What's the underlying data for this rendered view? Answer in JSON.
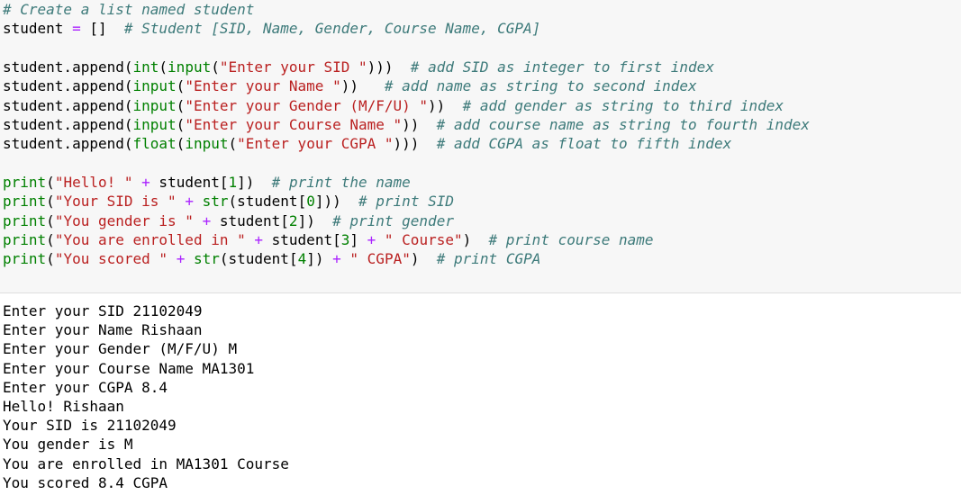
{
  "code_lines": [
    [
      "# Create a list named student"
    ],
    [
      "student ",
      "=",
      " []  ",
      "# Student [SID, Name, Gender, Course Name, CGPA]"
    ],
    [
      ""
    ],
    [
      "student.append(",
      "int",
      "(",
      "input",
      "(",
      "\"Enter your SID \"",
      ")))  ",
      "# add SID as integer to first index"
    ],
    [
      "student.append(",
      "input",
      "(",
      "\"Enter your Name \"",
      "))   ",
      "# add name as string to second index"
    ],
    [
      "student.append(",
      "input",
      "(",
      "\"Enter your Gender (M/F/U) \"",
      "))  ",
      "# add gender as string to third index"
    ],
    [
      "student.append(",
      "input",
      "(",
      "\"Enter your Course Name \"",
      "))  ",
      "# add course name as string to fourth index"
    ],
    [
      "student.append(",
      "float",
      "(",
      "input",
      "(",
      "\"Enter your CGPA \"",
      ")))  ",
      "# add CGPA as float to fifth index"
    ],
    [
      ""
    ],
    [
      "print",
      "(",
      "\"Hello! \"",
      " ",
      "+",
      " student[",
      "1",
      "])  ",
      "# print the name"
    ],
    [
      "print",
      "(",
      "\"Your SID is \"",
      " ",
      "+",
      " ",
      "str",
      "(student[",
      "0",
      "]))  ",
      "# print SID"
    ],
    [
      "print",
      "(",
      "\"You gender is \"",
      " ",
      "+",
      " student[",
      "2",
      "])  ",
      "# print gender"
    ],
    [
      "print",
      "(",
      "\"You are enrolled in \"",
      " ",
      "+",
      " student[",
      "3",
      "] ",
      "+",
      " ",
      "\" Course\"",
      ")  ",
      "# print course name"
    ],
    [
      "print",
      "(",
      "\"You scored \"",
      " ",
      "+",
      " ",
      "str",
      "(student[",
      "4",
      "]) ",
      "+",
      " ",
      "\" CGPA\"",
      ")  ",
      "# print CGPA"
    ]
  ],
  "code_styles": [
    [
      "c"
    ],
    [
      "",
      "o",
      "",
      "c"
    ],
    [
      ""
    ],
    [
      "",
      "b",
      "",
      "b",
      "",
      "s",
      "",
      "c"
    ],
    [
      "",
      "b",
      "",
      "s",
      "",
      "c"
    ],
    [
      "",
      "b",
      "",
      "s",
      "",
      "c"
    ],
    [
      "",
      "b",
      "",
      "s",
      "",
      "c"
    ],
    [
      "",
      "b",
      "",
      "b",
      "",
      "s",
      "",
      "c"
    ],
    [
      ""
    ],
    [
      "b",
      "",
      "s",
      "",
      "o",
      "",
      "n",
      "",
      "c"
    ],
    [
      "b",
      "",
      "s",
      "",
      "o",
      "",
      "b",
      "",
      "n",
      "",
      "c"
    ],
    [
      "b",
      "",
      "s",
      "",
      "o",
      "",
      "n",
      "",
      "c"
    ],
    [
      "b",
      "",
      "s",
      "",
      "o",
      "",
      "n",
      "",
      "o",
      "",
      "s",
      "",
      "c"
    ],
    [
      "b",
      "",
      "s",
      "",
      "o",
      "",
      "b",
      "",
      "n",
      "",
      "o",
      "",
      "s",
      "",
      "c"
    ]
  ],
  "output_lines": [
    "Enter your SID 21102049",
    "Enter your Name Rishaan",
    "Enter your Gender (M/F/U) M",
    "Enter your Course Name MA1301",
    "Enter your CGPA 8.4",
    "Hello! Rishaan",
    "Your SID is 21102049",
    "You gender is M",
    "You are enrolled in MA1301 Course",
    "You scored 8.4 CGPA"
  ]
}
